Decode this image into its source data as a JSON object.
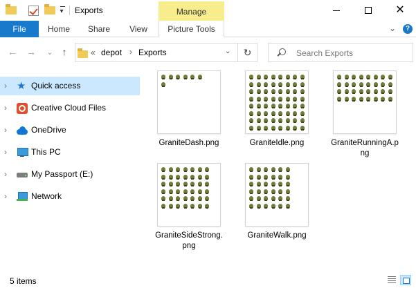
{
  "window": {
    "title": "Exports",
    "context_tab_group": "Manage",
    "minimize_icon": "minimize-icon",
    "maximize_icon": "maximize-icon",
    "close_glyph": "✕"
  },
  "quick_access_toolbar": {
    "icons": [
      "folder-icon",
      "properties-check-icon",
      "new-folder-icon",
      "customize-dropdown-icon"
    ]
  },
  "ribbon": {
    "tabs": [
      {
        "label": "File"
      },
      {
        "label": "Home"
      },
      {
        "label": "Share"
      },
      {
        "label": "View"
      },
      {
        "label": "Picture Tools"
      }
    ],
    "collapse_glyph": "⌄",
    "help_glyph": "?"
  },
  "navigation": {
    "back_glyph": "←",
    "forward_glyph": "→",
    "recent_glyph": "⌄",
    "up_glyph": "↑",
    "breadcrumb": {
      "overflow": "«",
      "items": [
        "depot",
        "Exports"
      ],
      "separator": "›",
      "dropdown_glyph": "⌄"
    },
    "refresh_glyph": "↻",
    "search": {
      "placeholder": "Search Exports"
    }
  },
  "sidebar": {
    "items": [
      {
        "label": "Quick access",
        "icon": "star-icon",
        "selected": true
      },
      {
        "label": "Creative Cloud Files",
        "icon": "creative-cloud-icon",
        "selected": false
      },
      {
        "label": "OneDrive",
        "icon": "cloud-icon",
        "selected": false
      },
      {
        "label": "This PC",
        "icon": "computer-icon",
        "selected": false
      },
      {
        "label": "My Passport (E:)",
        "icon": "drive-icon",
        "selected": false
      },
      {
        "label": "Network",
        "icon": "network-icon",
        "selected": false
      }
    ],
    "chevron_glyph": "›"
  },
  "files": [
    {
      "name": "GraniteDash.png",
      "grid": {
        "cols": 6,
        "rows": 2,
        "last_row": 1
      }
    },
    {
      "name": "GraniteIdle.png",
      "grid": {
        "cols": 8,
        "rows": 8,
        "last_row": 8
      }
    },
    {
      "name": "GraniteRunningA.png",
      "grid": {
        "cols": 8,
        "rows": 4,
        "last_row": 8
      }
    },
    {
      "name": "GraniteSideStrong.png",
      "grid": {
        "cols": 7,
        "rows": 6,
        "last_row": 7
      }
    },
    {
      "name": "GraniteWalk.png",
      "grid": {
        "cols": 6,
        "rows": 6,
        "last_row": 6
      }
    }
  ],
  "status_bar": {
    "item_count": "5 items",
    "views": [
      "details-view-icon",
      "large-icons-view-icon"
    ]
  }
}
